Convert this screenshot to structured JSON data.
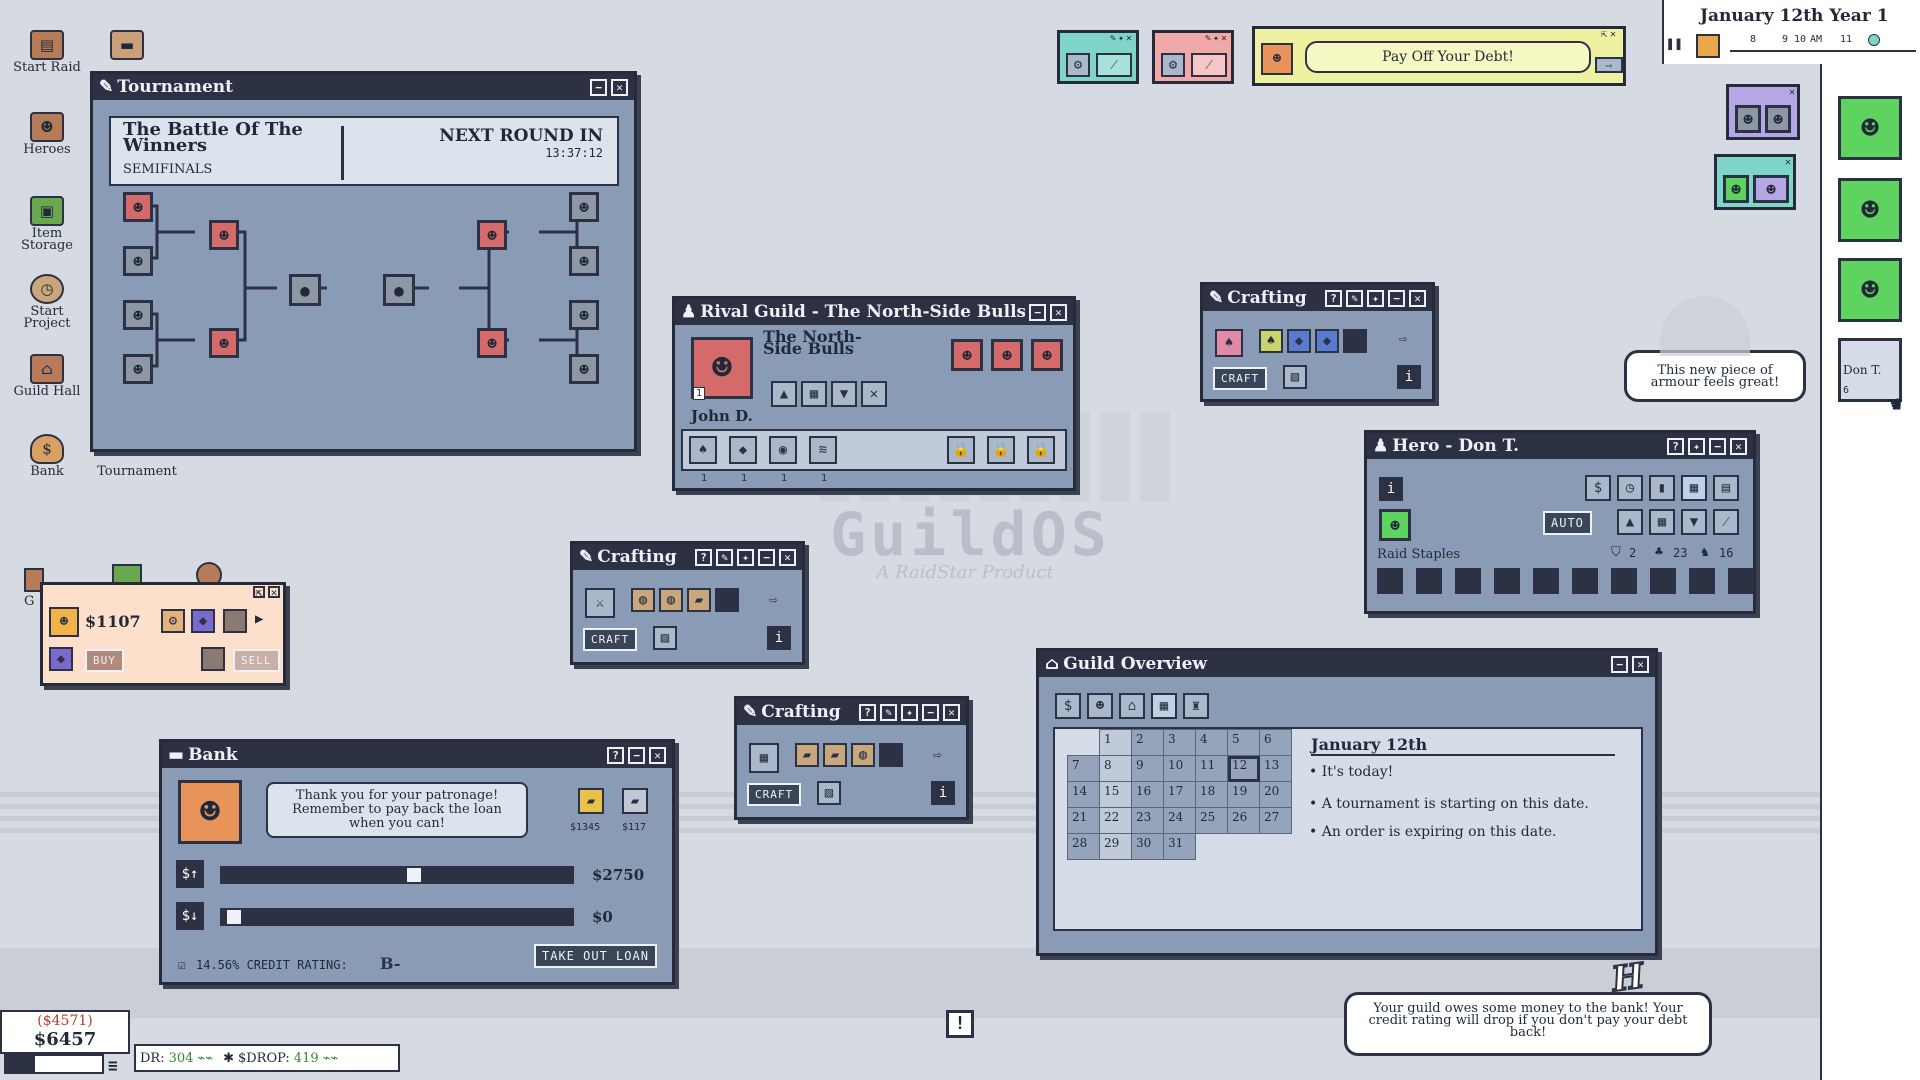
{
  "clock": {
    "date": "January 12th Year 1",
    "pause_icon": "pause-icon",
    "marks": [
      "8",
      "9",
      "10",
      "AM",
      "11"
    ]
  },
  "desktop": {
    "icons": [
      {
        "label": "Start Raid",
        "icon": "map-icon"
      },
      {
        "label": "Heroes",
        "icon": "heroes-icon"
      },
      {
        "label": "Item Storage",
        "icon": "chest-icon"
      },
      {
        "label": "Start Project",
        "icon": "clock-icon"
      },
      {
        "label": "Guild Hall",
        "icon": "house-icon"
      },
      {
        "label": "Bank",
        "icon": "money-bag-icon"
      },
      {
        "label": "Tournament",
        "icon": "flag-icon"
      }
    ],
    "partial_label": "G"
  },
  "tournament": {
    "title": "Tournament",
    "event": "The Battle Of The Winners",
    "stage": "SEMIFINALS",
    "next_round_label": "NEXT ROUND IN",
    "timer": "13:37:12"
  },
  "rival": {
    "title": "Rival Guild - The North-Side Bulls",
    "guild_name": "The North-Side Bulls",
    "leader": "John D.",
    "level": "1",
    "counts": [
      "1",
      "1",
      "1",
      "1"
    ]
  },
  "crafting": [
    {
      "title": "Crafting",
      "craft": "CRAFT"
    },
    {
      "title": "Crafting",
      "craft": "CRAFT"
    },
    {
      "title": "Crafting",
      "craft": "CRAFT"
    }
  ],
  "shop": {
    "price": "$1107",
    "buy": "BUY",
    "sell": "SELL"
  },
  "bank": {
    "title": "Bank",
    "message": "Thank you for your patronage! Remember to pay back the loan when you can!",
    "item1": "$1345",
    "item2": "$117",
    "borrow": "$2750",
    "repay": "$0",
    "borrow_fill": 0.55,
    "repay_fill": 0.02,
    "credit": "14.56% CREDIT RATING:",
    "grade": "B-",
    "loan_button": "TAKE OUT LOAN"
  },
  "hero": {
    "title": "Hero - Don T.",
    "auto": "AUTO",
    "role": "Raid Staples",
    "stat1": "2",
    "stat2": "23",
    "stat3": "16"
  },
  "overview": {
    "title": "Guild Overview",
    "date": "January 12th",
    "notes": [
      "It's today!",
      "A tournament is starting on this date.",
      "An order is expiring on this date."
    ],
    "days": [
      "1",
      "2",
      "3",
      "4",
      "5",
      "6",
      "7",
      "8",
      "9",
      "10",
      "11",
      "12",
      "13",
      "14",
      "15",
      "16",
      "17",
      "18",
      "19",
      "20",
      "21",
      "22",
      "23",
      "24",
      "25",
      "26",
      "27",
      "28",
      "29",
      "30",
      "31"
    ]
  },
  "quest": {
    "text": "Pay Off Your Debt!"
  },
  "hero_bubble": "This new piece of armour feels great!",
  "hero_tab": "Don T.",
  "hero_tab_level": "6",
  "watermark": {
    "name": "GuildOS",
    "tagline": "A RaidStar Product"
  },
  "notify": "Your guild owes some money to the bank! Your credit rating will drop if you don't pay your debt back!",
  "money": {
    "debt": "($4571)",
    "cash": "$6457"
  },
  "ticker": {
    "a_label": "DR:",
    "a_value": "304",
    "b_label": "$DROP:",
    "b_value": "419"
  },
  "colors": {
    "window": "#8a9cb5",
    "title": "#2c3243",
    "desktop": "#d6dae2",
    "accent_red": "#d46a6a",
    "hero_green": "#5fd35f",
    "debt_red": "#c0392b"
  }
}
